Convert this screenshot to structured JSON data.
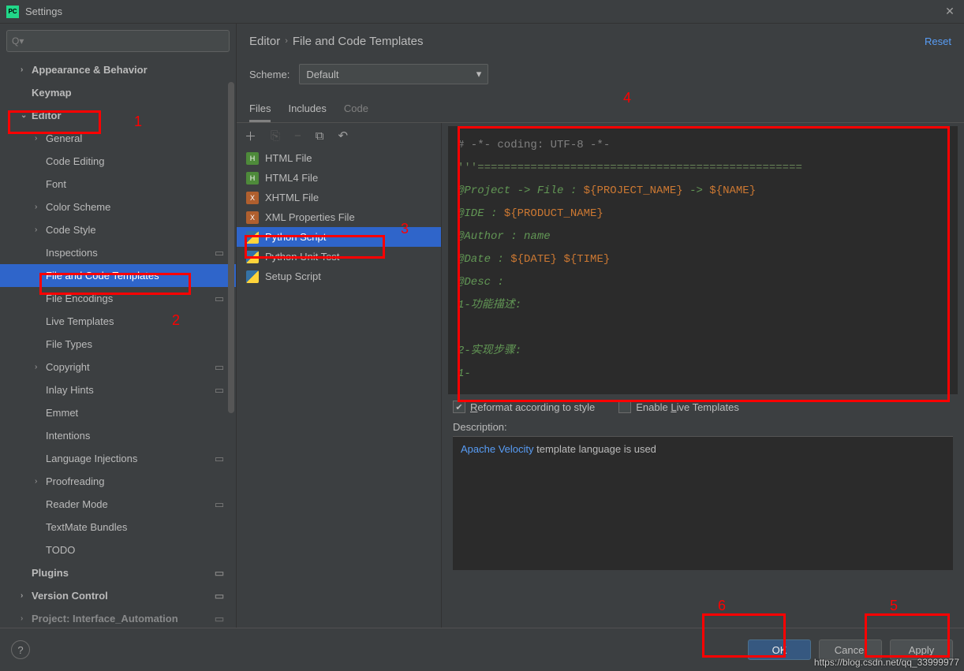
{
  "window": {
    "title": "Settings"
  },
  "search": {
    "placeholder": "Q▾"
  },
  "tree": {
    "appearance": "Appearance & Behavior",
    "keymap": "Keymap",
    "editor": "Editor",
    "general": "General",
    "code_editing": "Code Editing",
    "font": "Font",
    "color_scheme": "Color Scheme",
    "code_style": "Code Style",
    "inspections": "Inspections",
    "file_templates": "File and Code Templates",
    "file_encodings": "File Encodings",
    "live_templates": "Live Templates",
    "file_types": "File Types",
    "copyright": "Copyright",
    "inlay_hints": "Inlay Hints",
    "emmet": "Emmet",
    "intentions": "Intentions",
    "lang_injections": "Language Injections",
    "proofreading": "Proofreading",
    "reader_mode": "Reader Mode",
    "textmate": "TextMate Bundles",
    "todo": "TODO",
    "plugins": "Plugins",
    "version_control": "Version Control",
    "project": "Project: Interface_Automation"
  },
  "breadcrumb": {
    "a": "Editor",
    "b": "File and Code Templates",
    "reset": "Reset"
  },
  "scheme": {
    "label": "Scheme:",
    "value": "Default"
  },
  "tabs": {
    "files": "Files",
    "includes": "Includes",
    "code": "Code"
  },
  "file_list": {
    "html": "HTML File",
    "html4": "HTML4 File",
    "xhtml": "XHTML File",
    "xmlprops": "XML Properties File",
    "python": "Python Script",
    "pytest": "Python Unit Test",
    "setup": "Setup Script"
  },
  "code": {
    "l1": "# -*- coding: UTF-8 -*-",
    "l2": "'''=================================================",
    "l3a": "@Project -> File   : ",
    "l3b": "${PROJECT_NAME}",
    "l3c": " -> ",
    "l3d": "${NAME}",
    "l4a": "@IDE    : ",
    "l4b": "${PRODUCT_NAME}",
    "l5": "@Author : name",
    "l6a": "@Date   : ",
    "l6b": "${DATE}",
    "l6c": " ",
    "l6d": "${TIME}",
    "l7": "@Desc   :",
    "l8": "1-功能描述:",
    "l9": "",
    "l10": "2-实现步骤:",
    "l11": "    1-"
  },
  "checks": {
    "reformat": "Reformat according to style",
    "live": "Enable Live Templates"
  },
  "desc": {
    "label": "Description:",
    "link": "Apache Velocity",
    "rest": " template language is used"
  },
  "buttons": {
    "ok": "OK",
    "cancel": "Cancel",
    "apply": "Apply"
  },
  "annotations": {
    "n1": "1",
    "n2": "2",
    "n3": "3",
    "n4": "4",
    "n5": "5",
    "n6": "6"
  },
  "watermark": "https://blog.csdn.net/qq_33999977"
}
